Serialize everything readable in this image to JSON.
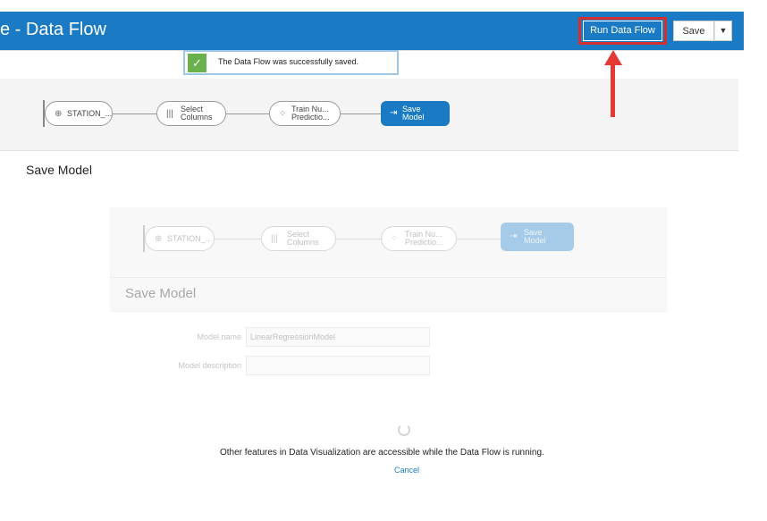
{
  "header": {
    "title": "e - Data Flow",
    "run_label": "Run Data Flow",
    "save_label": "Save",
    "caret": "▼",
    "accent": "#1a7bc4",
    "highlight": "#d32f2f"
  },
  "toast": {
    "check": "✓",
    "message": "The Data Flow was successfully saved."
  },
  "flow": {
    "nodes": [
      {
        "icon": "⊕",
        "label": "STATION_..."
      },
      {
        "icon": "|||",
        "label_top": "Select",
        "label_bottom": "Columns"
      },
      {
        "icon": "⁘",
        "label_top": "Train Nu...",
        "label_bottom": "Predictio..."
      },
      {
        "icon": "⇥",
        "label_top": "Save",
        "label_bottom": "Model"
      }
    ]
  },
  "section": {
    "title": "Save Model"
  },
  "dialog": {
    "title": "Save Model",
    "fields": [
      {
        "label": "Model name",
        "value": "LinearRegressionModel"
      },
      {
        "label": "Model description",
        "value": ""
      }
    ],
    "running_message": "Other features in Data Visualization are accessible while the Data Flow is running.",
    "cancel_label": "Cancel"
  }
}
